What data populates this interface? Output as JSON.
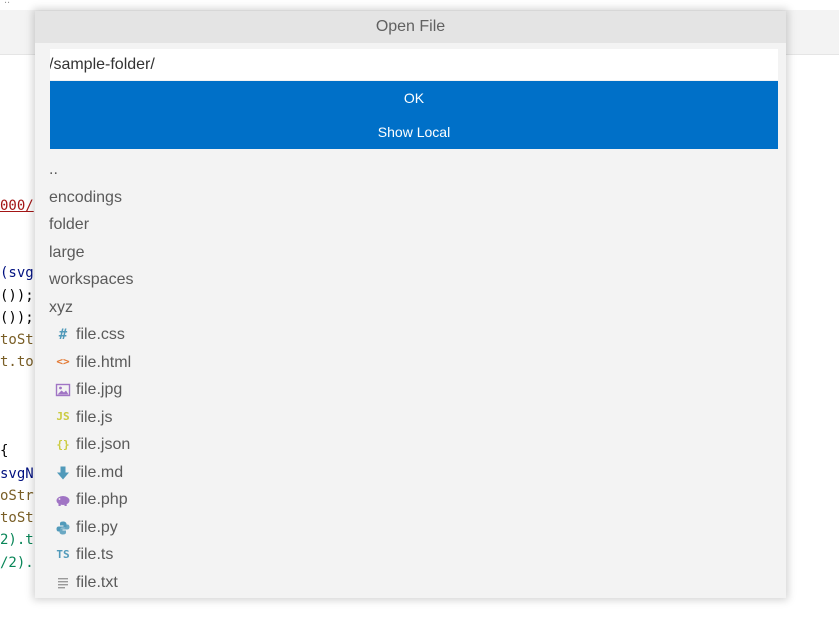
{
  "background": {
    "title_dots": "..",
    "code_lines": [
      {
        "text": "000/",
        "cls": "tok-red"
      },
      {
        "text": "(svg",
        "cls": "tok-blue"
      },
      {
        "text": "());",
        "cls": "tok-black"
      },
      {
        "text": "());",
        "cls": "tok-black"
      },
      {
        "text": "toSt",
        "cls": "tok-brown"
      },
      {
        "text": "t.to",
        "cls": "tok-brown"
      },
      {
        "text": "{",
        "cls": "tok-black"
      },
      {
        "text": "svgN",
        "cls": "tok-blue"
      },
      {
        "text": "oStr",
        "cls": "tok-brown"
      },
      {
        "text": "toSt",
        "cls": "tok-brown"
      },
      {
        "text": "2).t",
        "cls": "tok-green"
      },
      {
        "text": "/2).",
        "cls": "tok-green"
      }
    ]
  },
  "dialog": {
    "title": "Open File",
    "path_value": "/sample-folder/",
    "ok_label": "OK",
    "show_local_label": "Show Local",
    "items": [
      {
        "label": "..",
        "icon": "none"
      },
      {
        "label": "encodings",
        "icon": "none"
      },
      {
        "label": "folder",
        "icon": "none"
      },
      {
        "label": "large",
        "icon": "none"
      },
      {
        "label": "workspaces",
        "icon": "none"
      },
      {
        "label": "xyz",
        "icon": "none"
      },
      {
        "label": "file.css",
        "icon": "css-icon",
        "glyph": "#",
        "color": "#519aba"
      },
      {
        "label": "file.html",
        "icon": "html-icon",
        "glyph": "<>",
        "color": "#e37933"
      },
      {
        "label": "file.jpg",
        "icon": "image-icon",
        "color": "#a074c4"
      },
      {
        "label": "file.js",
        "icon": "javascript-icon",
        "glyph": "JS",
        "color": "#cbcb41"
      },
      {
        "label": "file.json",
        "icon": "json-icon",
        "glyph": "{}",
        "color": "#cbcb41"
      },
      {
        "label": "file.md",
        "icon": "markdown-icon",
        "color": "#519aba"
      },
      {
        "label": "file.php",
        "icon": "php-icon",
        "color": "#a074c4"
      },
      {
        "label": "file.py",
        "icon": "python-icon",
        "color": "#519aba"
      },
      {
        "label": "file.ts",
        "icon": "typescript-icon",
        "glyph": "TS",
        "color": "#519aba"
      },
      {
        "label": "file.txt",
        "icon": "text-file-icon",
        "color": "#9a9a9a"
      }
    ]
  }
}
